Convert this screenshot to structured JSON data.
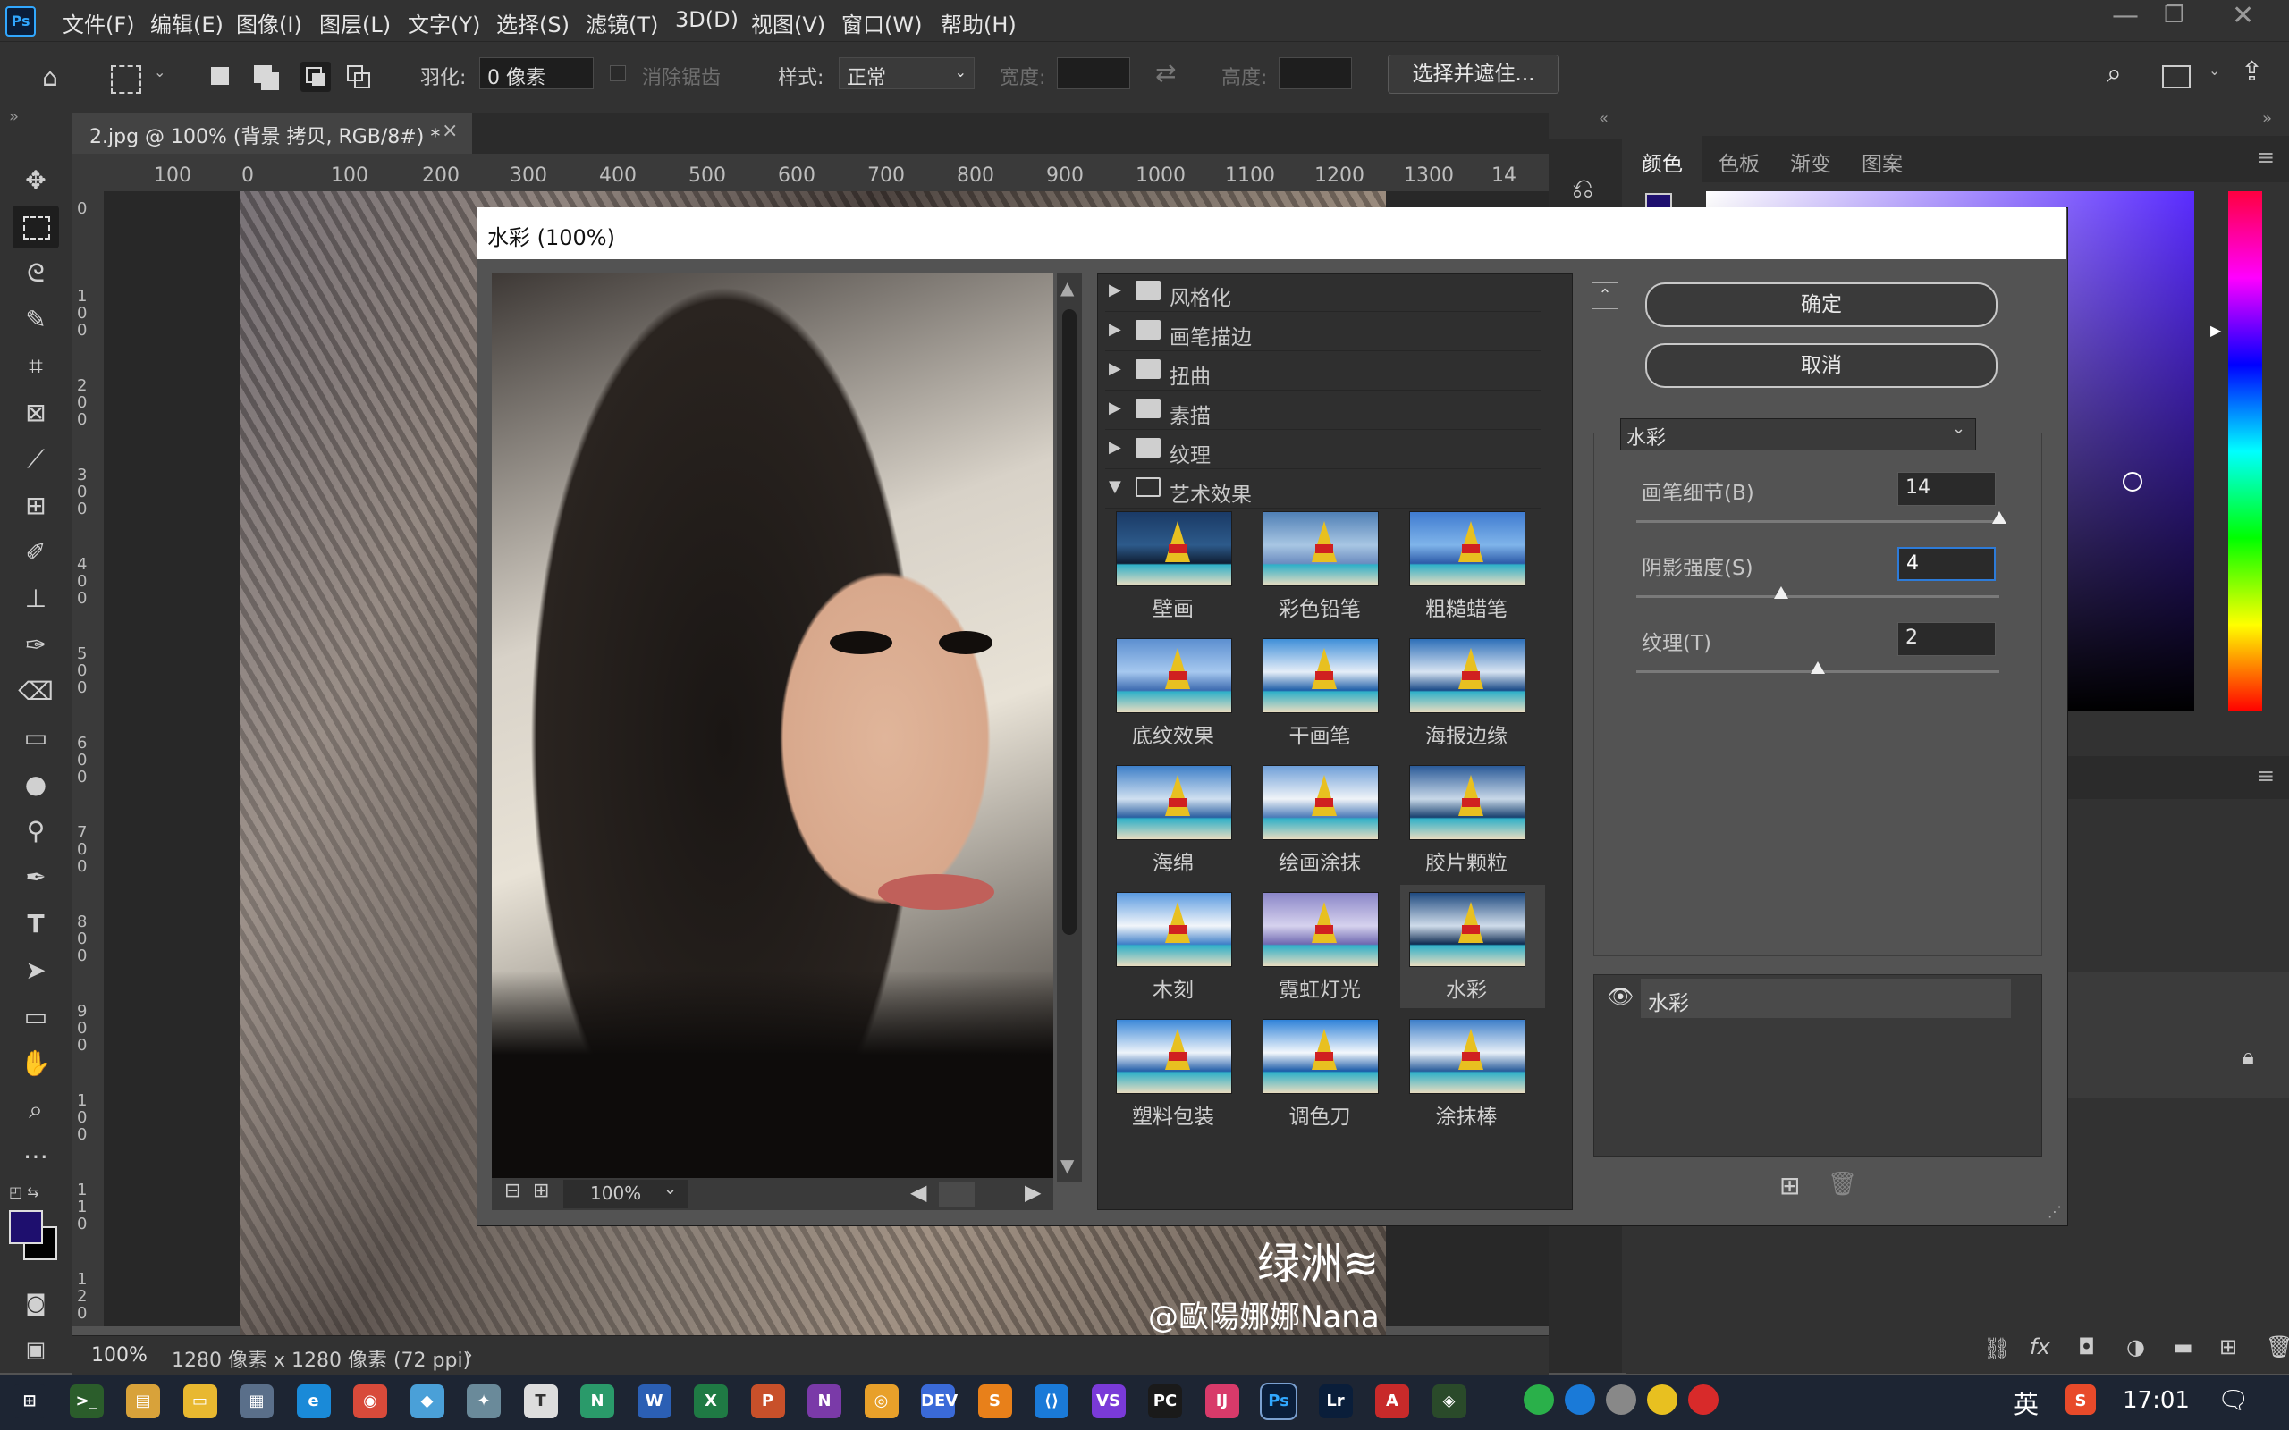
{
  "menubar": {
    "app_logo": "Ps",
    "items": [
      "文件(F)",
      "编辑(E)",
      "图像(I)",
      "图层(L)",
      "文字(Y)",
      "选择(S)",
      "滤镜(T)",
      "3D(D)",
      "视图(V)",
      "窗口(W)",
      "帮助(H)"
    ]
  },
  "options": {
    "feather_label": "羽化:",
    "feather_value": "0 像素",
    "antialias_label": "消除锯齿",
    "style_label": "样式:",
    "style_value": "正常",
    "width_label": "宽度:",
    "height_label": "高度:",
    "select_mask_btn": "选择并遮住..."
  },
  "document": {
    "tab_title": "2.jpg @ 100% (背景 拷贝, RGB/8#) *",
    "ruler_h": [
      "100",
      "0",
      "100",
      "200",
      "300",
      "400",
      "500",
      "600",
      "700",
      "800",
      "900",
      "1000",
      "1100",
      "1200",
      "1300",
      "14"
    ],
    "ruler_v": [
      "0",
      "1\n0\n0",
      "2\n0\n0",
      "3\n0\n0",
      "4\n0\n0",
      "5\n0\n0",
      "6\n0\n0",
      "7\n0\n0",
      "8\n0\n0",
      "9\n0\n0",
      "1\n0\n0",
      "1\n1\n0",
      "1\n2\n0"
    ],
    "zoom": "100%",
    "info": "1280 像素 x 1280 像素 (72 ppi)",
    "watermark_logo": "绿洲≋",
    "watermark_user": "@歐陽娜娜Nana"
  },
  "right_panel": {
    "tabs": [
      "颜色",
      "色板",
      "渐变",
      "图案"
    ],
    "fg_color": "#1e0f6e",
    "bg_color": "#000000"
  },
  "dialog": {
    "title": "水彩 (100%)",
    "preview_zoom": "100%",
    "folders": [
      {
        "label": "风格化",
        "open": false
      },
      {
        "label": "画笔描边",
        "open": false
      },
      {
        "label": "扭曲",
        "open": false
      },
      {
        "label": "素描",
        "open": false
      },
      {
        "label": "纹理",
        "open": false
      },
      {
        "label": "艺术效果",
        "open": true
      }
    ],
    "filters": [
      "壁画",
      "彩色铅笔",
      "粗糙蜡笔",
      "底纹效果",
      "干画笔",
      "海报边缘",
      "海绵",
      "绘画涂抹",
      "胶片颗粒",
      "木刻",
      "霓虹灯光",
      "水彩",
      "塑料包装",
      "调色刀",
      "涂抹棒"
    ],
    "selected_filter": "水彩",
    "ok": "确定",
    "cancel": "取消",
    "filter_select": "水彩",
    "params": [
      {
        "label": "画笔细节(B)",
        "value": "14",
        "level": 1.0
      },
      {
        "label": "阴影强度(S)",
        "value": "4",
        "level": 0.4
      },
      {
        "label": "纹理(T)",
        "value": "2",
        "level": 0.5
      }
    ],
    "layer_name": "水彩"
  },
  "taskbar": {
    "time": "17:01",
    "ime": "英"
  }
}
